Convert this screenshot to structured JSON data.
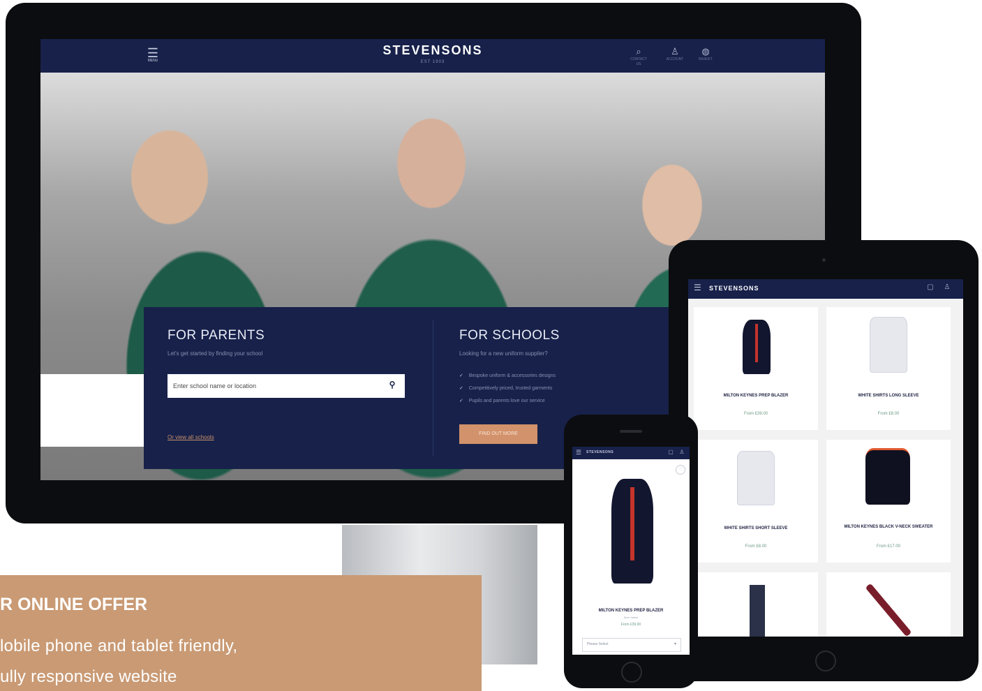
{
  "desktop": {
    "header": {
      "brand": "STEVENSONS",
      "brand_sub": "EST 1903",
      "menu_label": "MENU",
      "icons": [
        {
          "icon": "search-icon",
          "glyph": "⌕",
          "label": "CONTACT US"
        },
        {
          "icon": "account-icon",
          "glyph": "♙",
          "label": "ACCOUNT"
        },
        {
          "icon": "basket-icon",
          "glyph": "◍",
          "label": "BASKET"
        }
      ]
    },
    "parents": {
      "title": "FOR PARENTS",
      "subtitle": "Let's get started by finding your school",
      "search_placeholder": "Enter school name or location",
      "view_all": "Or view all schools"
    },
    "schools": {
      "title": "FOR SCHOOLS",
      "subtitle": "Looking for a new uniform supplier?",
      "bullets": [
        "Bespoke uniform & accessories designs",
        "Competitively priced, trusted garments",
        "Pupils and parents love our service"
      ],
      "cta": "FIND OUT MORE"
    }
  },
  "tablet": {
    "brand": "STEVENSONS",
    "products": [
      {
        "name": "MILTON KEYNES PREP BLAZER",
        "price": "From £39.00",
        "kind": "blazer"
      },
      {
        "name": "WHITE SHIRTS LONG SLEEVE",
        "price": "From £8.00",
        "kind": "shirt"
      },
      {
        "name": "WHITE SHIRTS SHORT SLEEVE",
        "price": "From £8.00",
        "kind": "shirt"
      },
      {
        "name": "MILTON KEYNES BLACK V-NECK SWEATER",
        "price": "From £17.00",
        "kind": "sweater"
      },
      {
        "name": "",
        "price": "",
        "kind": "trousers"
      },
      {
        "name": "",
        "price": "",
        "kind": "tie"
      }
    ]
  },
  "phone": {
    "brand": "STEVENSONS",
    "product_name": "MILTON KEYNES PREP BLAZER",
    "product_sub": "Size: select",
    "price": "From £39.00",
    "select_label": "Please Select"
  },
  "offer": {
    "title": "R ONLINE OFFER",
    "lines": [
      "lobile phone and tablet friendly,",
      "ully responsive website"
    ]
  },
  "colors": {
    "navy": "#17214a",
    "copper": "#d2926b",
    "offer_bg": "#c99a74"
  }
}
